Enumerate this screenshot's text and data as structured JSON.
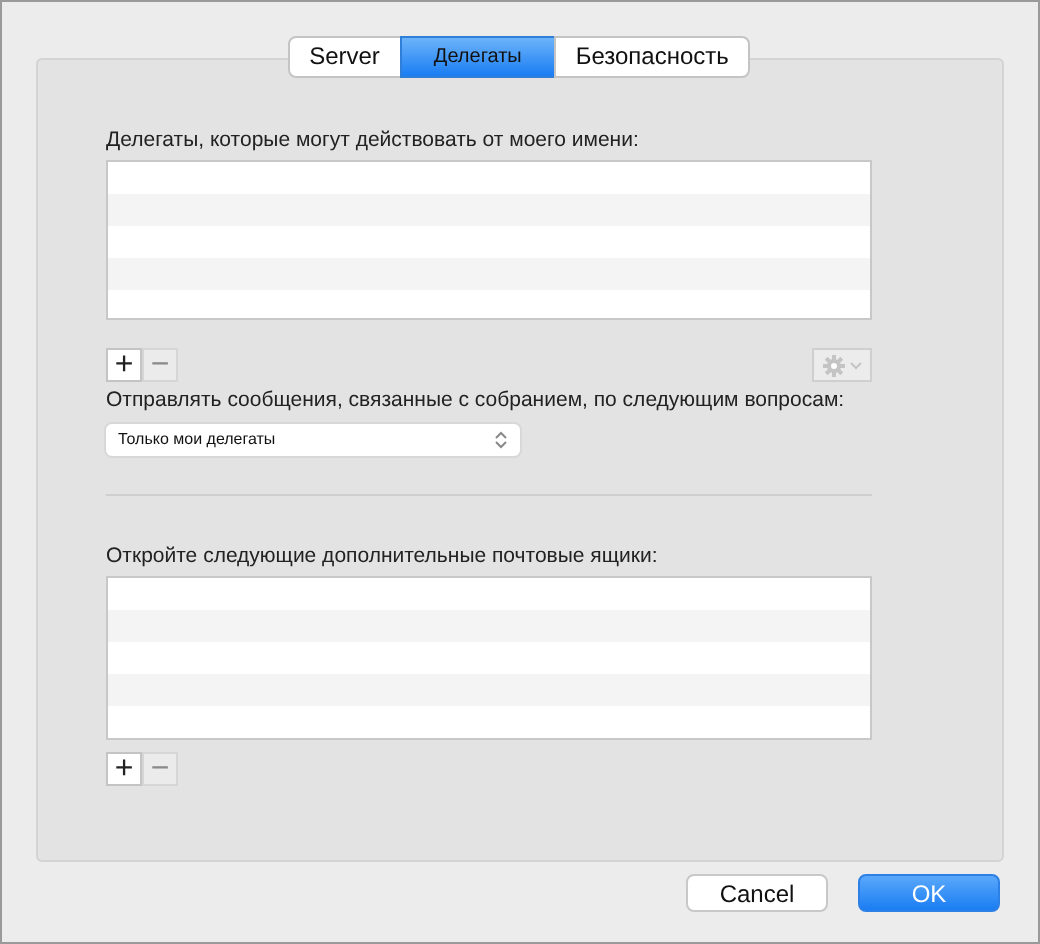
{
  "tabs": [
    {
      "label": "Server",
      "selected": false
    },
    {
      "label": "Делегаты",
      "selected": true
    },
    {
      "label": "Безопасность",
      "selected": false
    }
  ],
  "delegates": {
    "label": "Делегаты, которые могут действовать от моего имени:",
    "list_buttons": [
      {
        "label": "+",
        "disabled": false
      },
      {
        "label": "−",
        "disabled": true
      }
    ],
    "action_menu": {
      "disabled": true
    }
  },
  "send_messages": {
    "label": "Отправлять сообщения, связанные с собранием, по следующим вопросам:",
    "value": "Только мои делегаты"
  },
  "mailboxes": {
    "label": "Откройте следующие дополнительные почтовые ящики:",
    "list_buttons": [
      {
        "label": "+",
        "disabled": false
      },
      {
        "label": "−",
        "disabled": true
      }
    ]
  },
  "buttons": [
    {
      "label": "Cancel",
      "kind": "default"
    },
    {
      "label": "OK",
      "kind": "primary"
    }
  ]
}
